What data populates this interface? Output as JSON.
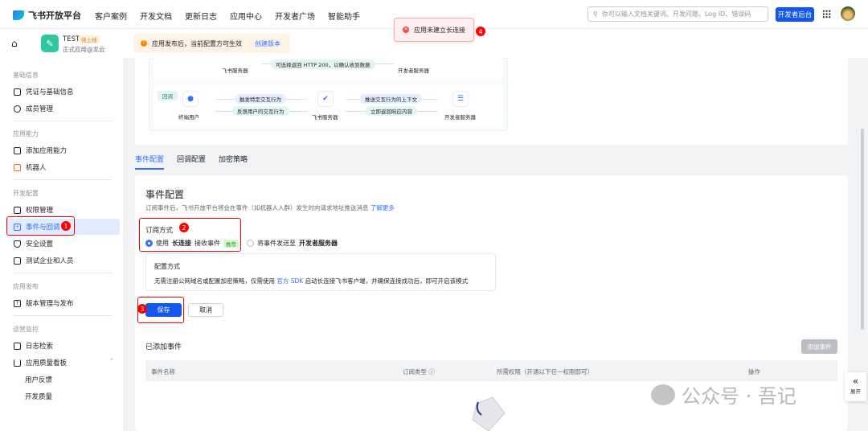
{
  "topnav": {
    "brand": "飞书开放平台",
    "links": [
      "客户案例",
      "开发文档",
      "更新日志",
      "应用中心",
      "开发者广场",
      "智能助手"
    ],
    "search_placeholder": "你可以输入文档关键词、开发问题、Log ID、错误码",
    "dev_console": "开发者后台"
  },
  "app": {
    "name": "TEST",
    "status": "待上线",
    "subtitle": "正式应用@龙云"
  },
  "notice": {
    "text": "应用发布后，当前配置方可生效",
    "link": "创建版本"
  },
  "toast": {
    "text": "应用未建立长连接"
  },
  "markers": [
    "1",
    "2",
    "3",
    "4"
  ],
  "sidebar": {
    "sections": [
      {
        "title": "基础信息",
        "items": [
          "凭证与基础信息",
          "成员管理"
        ]
      },
      {
        "title": "应用能力",
        "items": [
          "添加应用能力",
          "机器人"
        ]
      },
      {
        "title": "开发配置",
        "items": [
          "权限管理",
          "事件与回调",
          "安全设置",
          "测试企业和人员"
        ]
      },
      {
        "title": "应用发布",
        "items": [
          "版本管理与发布"
        ]
      },
      {
        "title": "运营监控",
        "items": [
          "日志检索",
          "应用质量看板"
        ],
        "subitems": [
          "用户反馈",
          "开发质量"
        ]
      }
    ],
    "active": "事件与回调"
  },
  "diagram": {
    "row1": {
      "pill": "可选择返回 HTTP 200，以确认收到数据",
      "left": "飞书服务器",
      "right": "开发者服务器"
    },
    "row2": {
      "tag": "回调",
      "user": "终端用户",
      "server": "飞书服务器",
      "dev": "开发者服务器",
      "pills": [
        "触发特定交互行为",
        "反馈用户的交互行为",
        "推送交互行为的上下文",
        "立即返回响应内容"
      ]
    }
  },
  "tabs": [
    "事件配置",
    "回调配置",
    "加密策略"
  ],
  "event_config": {
    "title": "事件配置",
    "desc": "订阅事件后，飞书开放平台将会在事件（如机器人入群）发生时向请求地址推送消息",
    "learn_more": "了解更多",
    "sub_label": "订阅方式",
    "option1": {
      "pre": "使用",
      "bold": "长连接",
      "post": "接收事件",
      "tag": "推荐",
      "selected": true
    },
    "option2": {
      "pre": "将事件发送至",
      "bold": "开发者服务器",
      "selected": false
    },
    "config_title": "配置方式",
    "config_pre": "无需注册公网域名或配置加密策略，仅需使用",
    "config_link": "官方 SDK",
    "config_post": "启动长连接飞书客户端，并确保连接成功后，即可开启该模式",
    "save": "保存",
    "cancel": "取消"
  },
  "events": {
    "title": "已添加事件",
    "add": "添加事件",
    "columns": [
      "事件名称",
      "订阅类型 ⓘ",
      "所需权限（开通以下任一权限即可）",
      "操作"
    ]
  },
  "watermark": "公众号 · 吾记",
  "expand": {
    "icon": "«",
    "label": "展开"
  }
}
